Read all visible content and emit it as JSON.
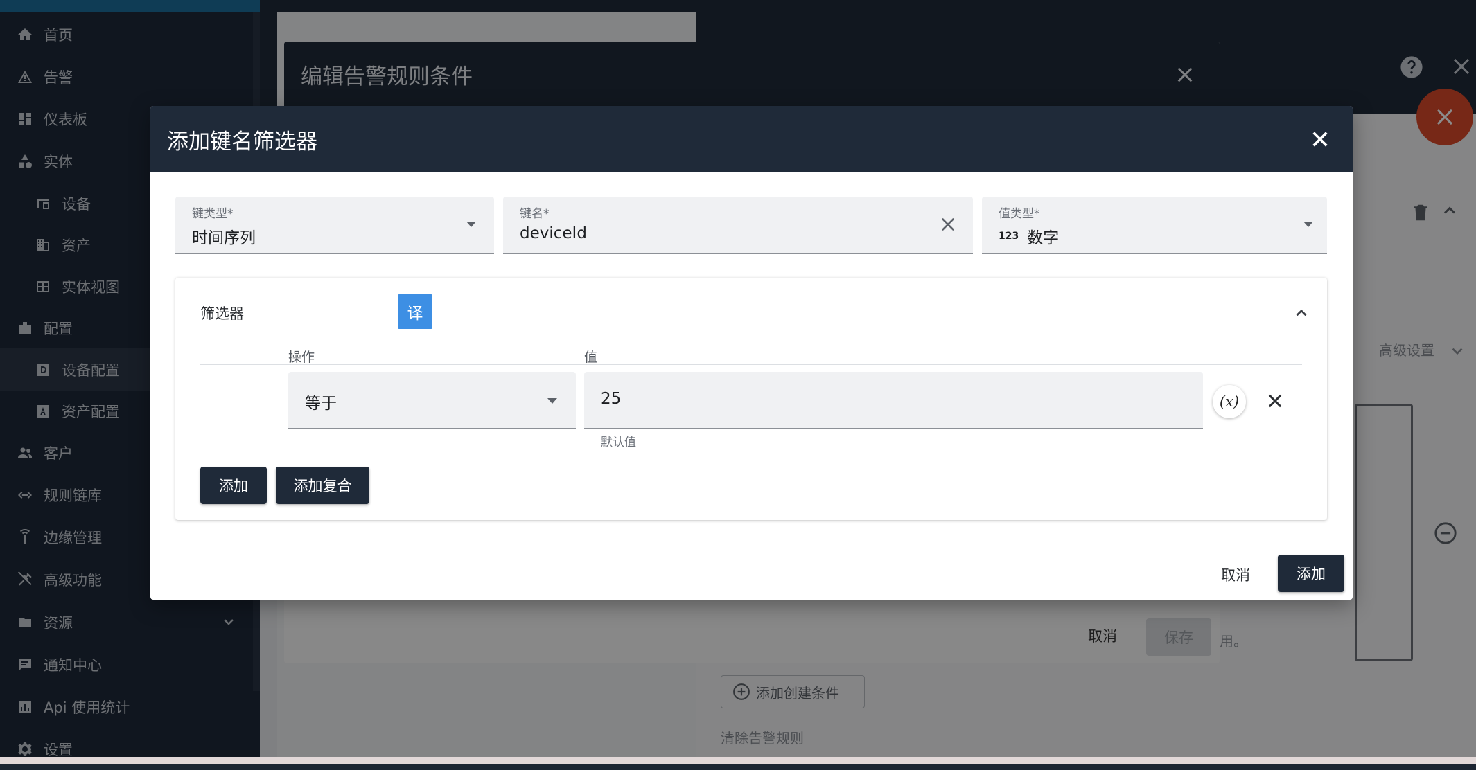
{
  "sidebar": {
    "items": [
      {
        "label": "首页",
        "icon": "home-icon"
      },
      {
        "label": "告警",
        "icon": "warning-icon"
      },
      {
        "label": "仪表板",
        "icon": "dashboard-icon"
      },
      {
        "label": "实体",
        "icon": "entity-icon"
      },
      {
        "label": "设备",
        "icon": "device-icon"
      },
      {
        "label": "资产",
        "icon": "asset-icon"
      },
      {
        "label": "实体视图",
        "icon": "entity-view-icon"
      },
      {
        "label": "配置",
        "icon": "profile-icon"
      },
      {
        "label": "设备配置",
        "icon": "device-profile-icon"
      },
      {
        "label": "资产配置",
        "icon": "asset-profile-icon"
      },
      {
        "label": "客户",
        "icon": "customers-icon"
      },
      {
        "label": "规则链库",
        "icon": "rule-chain-icon"
      },
      {
        "label": "边缘管理",
        "icon": "edge-icon"
      },
      {
        "label": "高级功能",
        "icon": "tools-icon"
      },
      {
        "label": "资源",
        "icon": "folder-icon"
      },
      {
        "label": "通知中心",
        "icon": "notification-icon"
      },
      {
        "label": "Api 使用统计",
        "icon": "chart-icon"
      },
      {
        "label": "设置",
        "icon": "gear-icon"
      }
    ]
  },
  "background": {
    "advanced_settings": "高级设置",
    "add_create_condition": "添加创建条件",
    "clear_alarm_rule": "清除告警规则",
    "hint_fragment": "用。"
  },
  "back_dialog": {
    "title": "编辑告警规则条件",
    "cancel": "取消",
    "save": "保存"
  },
  "dialog": {
    "title": "添加键名筛选器",
    "key_type": {
      "label": "键类型*",
      "value": "时间序列"
    },
    "key_name": {
      "label": "键名*",
      "value": "deviceId"
    },
    "value_type": {
      "label": "值类型*",
      "value": "数字",
      "icon_text": "123"
    },
    "filters": {
      "title": "筛选器",
      "col_operation": "操作",
      "col_value": "值",
      "operation_value": "等于",
      "value": "25",
      "value_hint": "默认值",
      "variable_button": "(x)",
      "translate_badge": "译",
      "add": "添加",
      "add_complex": "添加复合"
    },
    "cancel": "取消",
    "add": "添加"
  },
  "colors": {
    "sidebar_bg": "#1e2939",
    "dialog_header": "#1f2a39",
    "primary_button": "#1f2a39",
    "fab": "#d94a2a",
    "translate_badge": "#3d8fe4"
  }
}
